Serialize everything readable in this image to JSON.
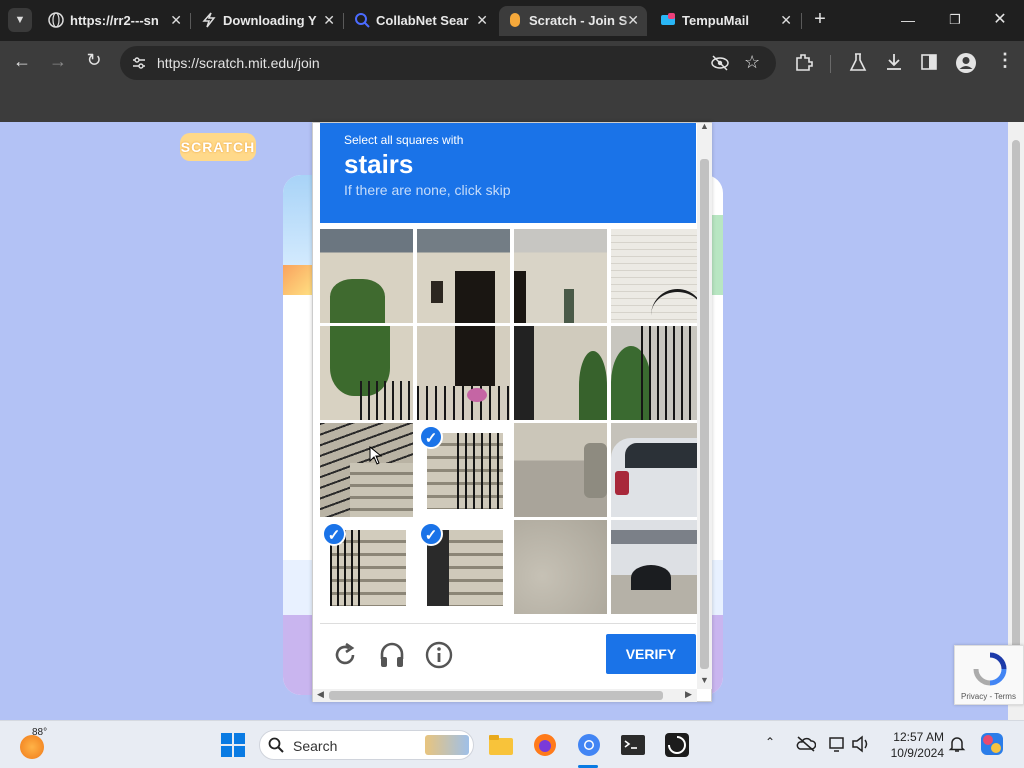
{
  "browser": {
    "tabs": [
      {
        "title": "https://rr2---sn",
        "favicon": "globe-icon"
      },
      {
        "title": "Downloading Y",
        "favicon": "lightning-icon"
      },
      {
        "title": "CollabNet Sear",
        "favicon": "magnifier-icon"
      },
      {
        "title": "Scratch - Join S",
        "favicon": "scratch-icon",
        "active": true
      },
      {
        "title": "TempuMail",
        "favicon": "mail-icon"
      }
    ],
    "new_tab": "+",
    "url": "https://scratch.mit.edu/join"
  },
  "page": {
    "logo_text": "SCRATCH"
  },
  "captcha": {
    "instruction": "Select all squares with",
    "target": "stairs",
    "hint": "If there are none, click skip",
    "selected_tiles": [
      9,
      12,
      13
    ],
    "verify_label": "VERIFY"
  },
  "recaptcha_badge": {
    "text": "Privacy - Terms"
  },
  "taskbar": {
    "weather_temp": "88°",
    "search_placeholder": "Search",
    "time": "12:57 AM",
    "date": "10/9/2024"
  },
  "colors": {
    "accent": "#1a73e8",
    "page_bg": "#b3c2f5",
    "chrome_dark": "#1f1f1f"
  }
}
